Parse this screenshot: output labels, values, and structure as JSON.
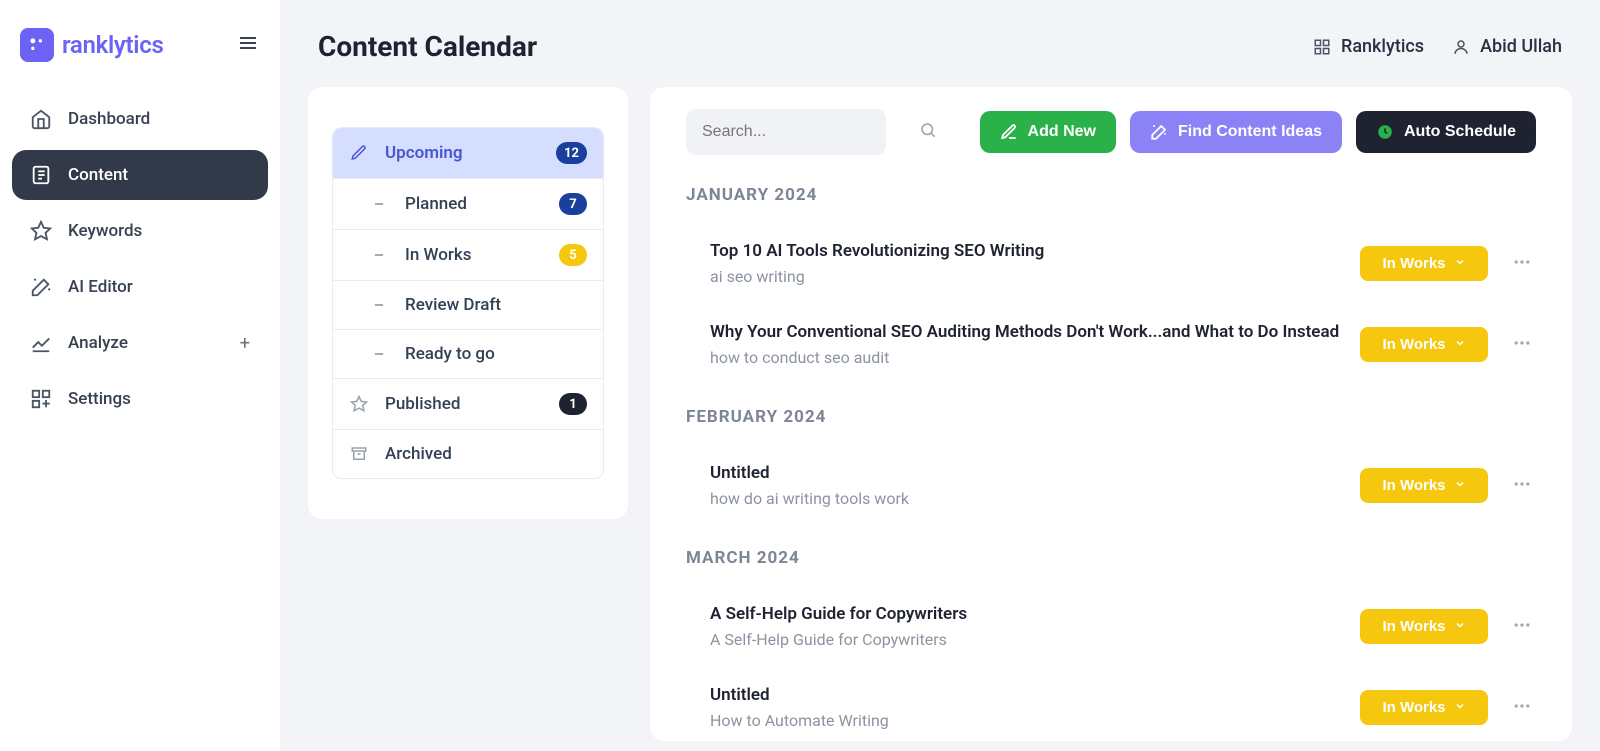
{
  "brand": "ranklytics",
  "page_title": "Content Calendar",
  "org_name": "Ranklytics",
  "user_name": "Abid Ullah",
  "sidebar": {
    "items": [
      {
        "label": "Dashboard",
        "icon": "home",
        "active": false,
        "expandable": false
      },
      {
        "label": "Content",
        "icon": "content",
        "active": true,
        "expandable": false
      },
      {
        "label": "Keywords",
        "icon": "star",
        "active": false,
        "expandable": false
      },
      {
        "label": "AI Editor",
        "icon": "wand",
        "active": false,
        "expandable": false
      },
      {
        "label": "Analyze",
        "icon": "chart",
        "active": false,
        "expandable": true
      },
      {
        "label": "Settings",
        "icon": "grid",
        "active": false,
        "expandable": false
      }
    ]
  },
  "filters": [
    {
      "label": "Upcoming",
      "icon": "pencil",
      "badge": "12",
      "badge_color": "blue",
      "level": 0,
      "selected": true
    },
    {
      "label": "Planned",
      "icon": "dash",
      "badge": "7",
      "badge_color": "blue2",
      "level": 1,
      "selected": false
    },
    {
      "label": "In Works",
      "icon": "dash",
      "badge": "5",
      "badge_color": "yellow",
      "level": 1,
      "selected": false
    },
    {
      "label": "Review Draft",
      "icon": "dash",
      "badge": "",
      "badge_color": "",
      "level": 1,
      "selected": false
    },
    {
      "label": "Ready to go",
      "icon": "dash",
      "badge": "",
      "badge_color": "",
      "level": 1,
      "selected": false
    },
    {
      "label": "Published",
      "icon": "staro",
      "badge": "1",
      "badge_color": "dark",
      "level": 0,
      "selected": false
    },
    {
      "label": "Archived",
      "icon": "archive",
      "badge": "",
      "badge_color": "",
      "level": 0,
      "selected": false
    }
  ],
  "search_placeholder": "Search...",
  "buttons": {
    "add_new": "Add New",
    "find_ideas": "Find Content Ideas",
    "auto_schedule": "Auto Schedule"
  },
  "status_label": "In Works",
  "groups": [
    {
      "label": "JANUARY 2024",
      "entries": [
        {
          "title": "Top 10 AI Tools Revolutionizing SEO Writing",
          "subtitle": "ai seo writing",
          "status": "In Works"
        },
        {
          "title": "Why Your Conventional SEO Auditing Methods Don't Work...and What to Do Instead",
          "subtitle": "how to conduct seo audit",
          "status": "In Works"
        }
      ]
    },
    {
      "label": "FEBRUARY 2024",
      "entries": [
        {
          "title": "Untitled",
          "subtitle": "how do ai writing tools work",
          "status": "In Works"
        }
      ]
    },
    {
      "label": "MARCH 2024",
      "entries": [
        {
          "title": "A Self-Help Guide for Copywriters",
          "subtitle": "A Self-Help Guide for Copywriters",
          "status": "In Works"
        },
        {
          "title": "Untitled",
          "subtitle": "How to Automate Writing",
          "status": "In Works"
        }
      ]
    }
  ]
}
